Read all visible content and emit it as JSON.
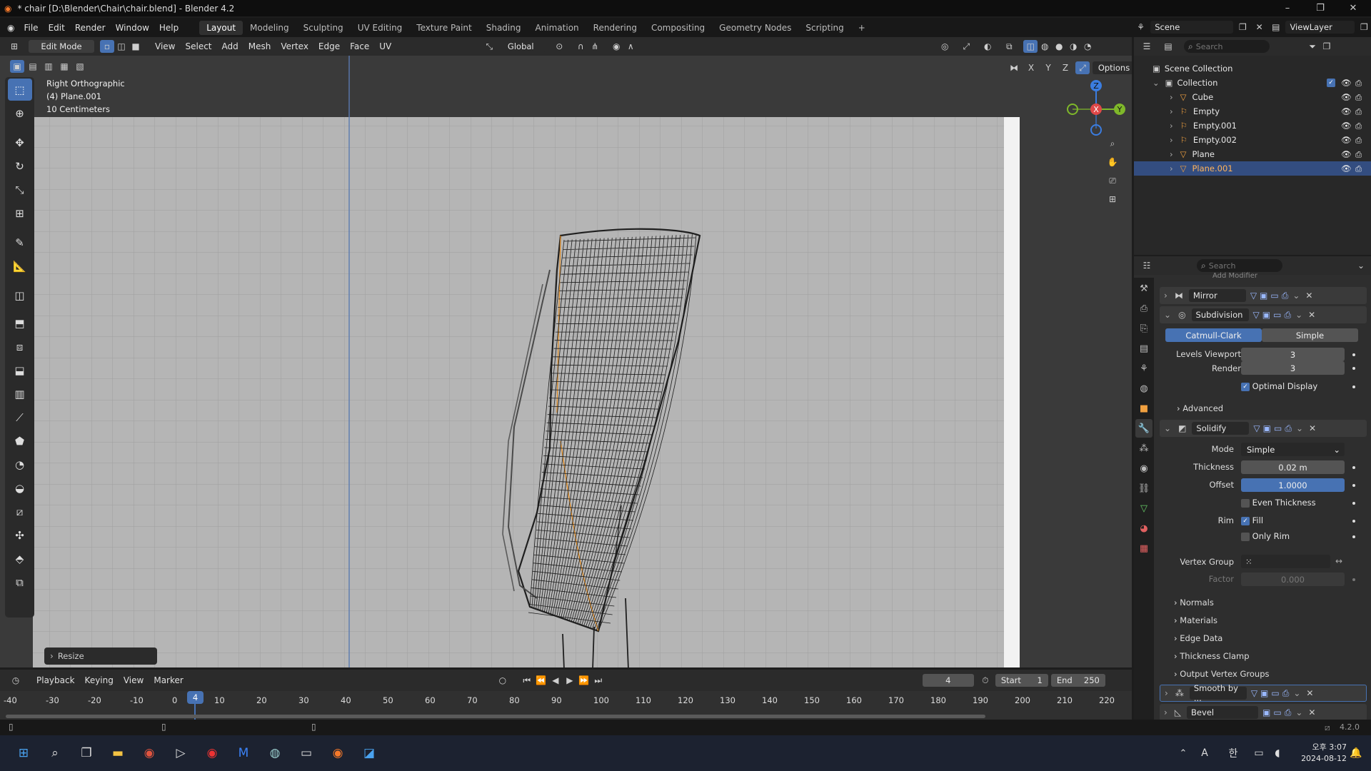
{
  "window": {
    "title": "* chair [D:\\Blender\\Chair\\chair.blend] - Blender 4.2",
    "min": "–",
    "max": "❐",
    "close": "✕"
  },
  "menu": [
    "File",
    "Edit",
    "Render",
    "Window",
    "Help"
  ],
  "workspaces": [
    "Layout",
    "Modeling",
    "Sculpting",
    "UV Editing",
    "Texture Paint",
    "Shading",
    "Animation",
    "Rendering",
    "Compositing",
    "Geometry Nodes",
    "Scripting"
  ],
  "active_workspace": "Layout",
  "scene": {
    "label": "Scene",
    "viewlayer": "ViewLayer"
  },
  "header3d": {
    "mode": "Edit Mode",
    "menus": [
      "View",
      "Select",
      "Add",
      "Mesh",
      "Vertex",
      "Edge",
      "Face",
      "UV"
    ],
    "orientation": "Global",
    "options": "Options",
    "axes": [
      "X",
      "Y",
      "Z"
    ]
  },
  "viewport": {
    "view_name": "Right Orthographic",
    "object": "(4) Plane.001",
    "scale": "10 Centimeters",
    "last_op": "Resize",
    "gizmo": {
      "z": "Z",
      "y": "Y",
      "x": "X"
    }
  },
  "outliner": {
    "search_placeholder": "Search",
    "root": "Scene Collection",
    "collection": "Collection",
    "items": [
      {
        "name": "Cube"
      },
      {
        "name": "Empty"
      },
      {
        "name": "Empty.001"
      },
      {
        "name": "Empty.002"
      },
      {
        "name": "Plane"
      },
      {
        "name": "Plane.001",
        "selected": true
      }
    ]
  },
  "properties": {
    "search_placeholder": "Search",
    "add_modifier": "Add Modifier",
    "mirror": {
      "name": "Mirror"
    },
    "subdivision": {
      "name": "Subdivision",
      "type_a": "Catmull-Clark",
      "type_b": "Simple",
      "levels_label": "Levels Viewport",
      "levels": "3",
      "render_label": "Render",
      "render": "3",
      "optimal": "Optimal Display",
      "advanced": "Advanced"
    },
    "solidify": {
      "name": "Solidify",
      "mode_label": "Mode",
      "mode": "Simple",
      "thickness_label": "Thickness",
      "thickness": "0.02 m",
      "offset_label": "Offset",
      "offset": "1.0000",
      "even": "Even Thickness",
      "rim_label": "Rim",
      "fill": "Fill",
      "only_rim": "Only Rim",
      "vgroup_label": "Vertex Group",
      "factor_label": "Factor",
      "factor": "0.000",
      "sections": [
        "Normals",
        "Materials",
        "Edge Data",
        "Thickness Clamp",
        "Output Vertex Groups"
      ]
    },
    "smooth": {
      "name": "Smooth by ..."
    },
    "bevel": {
      "name": "Bevel"
    }
  },
  "timeline": {
    "menus": [
      "Playback",
      "Keying",
      "View",
      "Marker"
    ],
    "current": "4",
    "start_label": "Start",
    "start": "1",
    "end_label": "End",
    "end": "250",
    "ticks": [
      "-40",
      "-30",
      "-20",
      "-10",
      "0",
      "10",
      "20",
      "30",
      "40",
      "50",
      "60",
      "70",
      "80",
      "90",
      "100",
      "110",
      "120",
      "130",
      "140",
      "150",
      "160",
      "170",
      "180",
      "190",
      "200",
      "210",
      "220"
    ],
    "current_frame": "4"
  },
  "status": {
    "version": "4.2.0"
  },
  "taskbar": {
    "time": "오후 3:07",
    "date": "2024-08-12",
    "ime": "A",
    "lang": "한"
  }
}
